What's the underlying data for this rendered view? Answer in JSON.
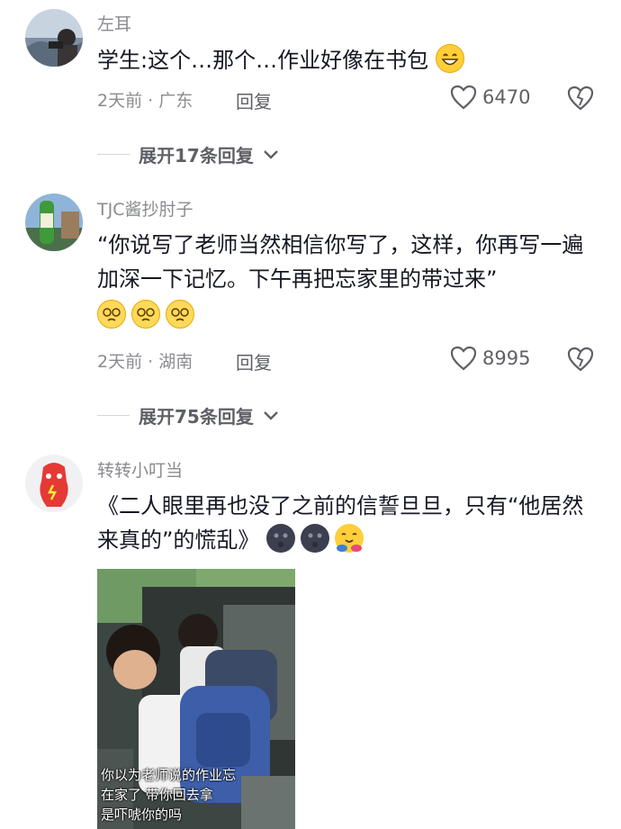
{
  "comments": [
    {
      "username": "左耳",
      "text": "学生:这个…那个…作业好像在书包",
      "meta": "2天前 · 广东",
      "reply_label": "回复",
      "likes": "6470",
      "expand_label": "展开17条回复"
    },
    {
      "username": "TJC酱抄肘子",
      "text": "“你说写了老师当然相信你写了，这样，你再写一遍加深一下记忆。下午再把忘家里的带过来”",
      "meta": "2天前 · 湖南",
      "reply_label": "回复",
      "likes": "8995",
      "expand_label": "展开75条回复"
    },
    {
      "username": "转转小叮当",
      "text": "《二人眼里再也没了之前的信誓旦旦，只有“他居然来真的”的慌乱》",
      "video_caption": [
        "你以为老师说的作业忘",
        "在家了 带你回去拿",
        "是吓唬你的吗"
      ]
    }
  ],
  "icons": {
    "like": "heart-outline-icon",
    "dislike": "broken-heart-icon",
    "expand": "chevron-down-icon"
  },
  "colors": {
    "text_primary": "#161823",
    "text_secondary": "#8a8b91",
    "background": "#ffffff"
  }
}
